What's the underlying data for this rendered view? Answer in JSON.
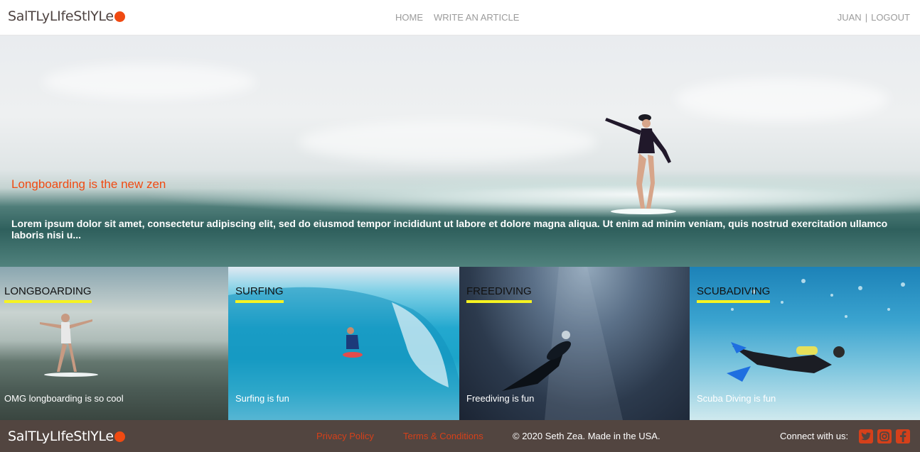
{
  "header": {
    "logo_text": "SalTLyLIfeStlYLe",
    "nav": {
      "home": "HOME",
      "write": "WRITE AN ARTICLE"
    },
    "user": {
      "name": "JUAN",
      "separator": "|",
      "logout": "LOGOUT"
    }
  },
  "hero": {
    "title": "Longboarding is the new zen",
    "text": "Lorem ipsum dolor sit amet, consectetur adipiscing elit, sed do eiusmod tempor incididunt ut labore et dolore magna aliqua. Ut enim ad minim veniam, quis nostrud exercitation ullamco laboris nisi u..."
  },
  "cards": [
    {
      "title": "LONGBOARDING",
      "caption": "OMG longboarding is so cool"
    },
    {
      "title": "SURFING",
      "caption": "Surfing is fun"
    },
    {
      "title": "FREEDIVING",
      "caption": "Freediving is fun"
    },
    {
      "title": "SCUBADIVING",
      "caption": "Scuba Diving is fun"
    }
  ],
  "footer": {
    "logo_text": "SalTLyLIfeStlYLe",
    "privacy": "Privacy Policy",
    "terms": "Terms & Conditions",
    "copyright": "© 2020 Seth Zea. Made in the USA.",
    "connect": "Connect with us:",
    "social_icons": [
      "twitter-icon",
      "instagram-icon",
      "facebook-icon"
    ]
  },
  "colors": {
    "accent": "#f04a12",
    "underline": "#f6f321",
    "footer_bg": "#524540"
  }
}
